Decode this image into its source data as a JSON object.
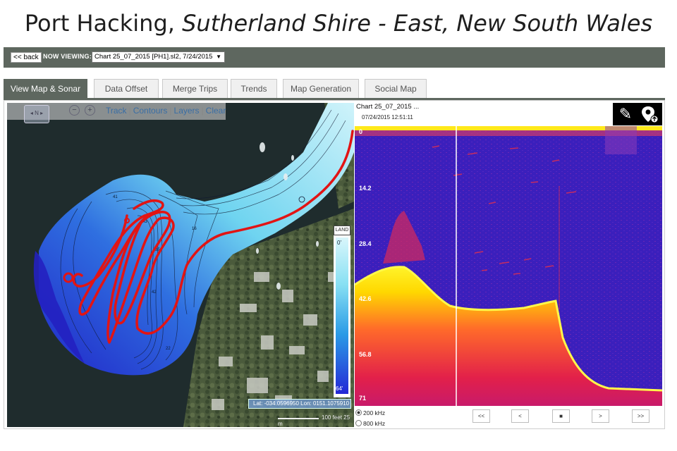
{
  "page": {
    "title_place": "Port Hacking, ",
    "title_region": "Sutherland Shire - East, New South Wales"
  },
  "viewbar": {
    "back_label": "<< back",
    "now_viewing_label": "NOW VIEWING:",
    "selected_chart": "Chart 25_07_2015 [PH1].sl2, 7/24/2015"
  },
  "tabs": [
    {
      "label": "View Map & Sonar",
      "active": true
    },
    {
      "label": "Data Offset",
      "active": false
    },
    {
      "label": "Merge Trips",
      "active": false
    },
    {
      "label": "Trends",
      "active": false
    },
    {
      "label": "Map Generation",
      "active": false
    },
    {
      "label": "Social Map",
      "active": false
    }
  ],
  "map": {
    "compass_label": "N",
    "zoom_out_label": "−",
    "zoom_in_label": "+",
    "links": [
      "Track",
      "Contours",
      "Layers",
      "Clear"
    ],
    "legend": {
      "header": "LAND",
      "top_value": "0'",
      "bottom_value": "64'"
    },
    "latlon": "Lat: -034.0596950 Lon: 0151.1075910",
    "scale_feet": "100 feet",
    "scale_m": "25 m",
    "colors": {
      "track": "#e01616",
      "deep": "#2428d6",
      "shallow": "#d9f6fb",
      "land": "#4a5a3e",
      "water": "#1d2a2b"
    }
  },
  "sonar": {
    "chart_title": "Chart 25_07_2015 ...",
    "timestamp": "07/24/2015 12:51:11",
    "depth_labels": [
      "0",
      "14.2",
      "28.4",
      "42.6",
      "56.8",
      "71"
    ],
    "edit_icon": "edit-icon",
    "pin_icon": "map-pin-icon",
    "colors": {
      "water": "#3a20b8",
      "bottom": "#ffe600",
      "clutter": "#e8263c"
    }
  },
  "frequencies": [
    {
      "label": "200 kHz",
      "selected": true
    },
    {
      "label": "800 kHz",
      "selected": false
    }
  ],
  "playback": {
    "rewind": "<<",
    "prev": "<",
    "stop": "■",
    "next": ">",
    "forward": ">>"
  }
}
